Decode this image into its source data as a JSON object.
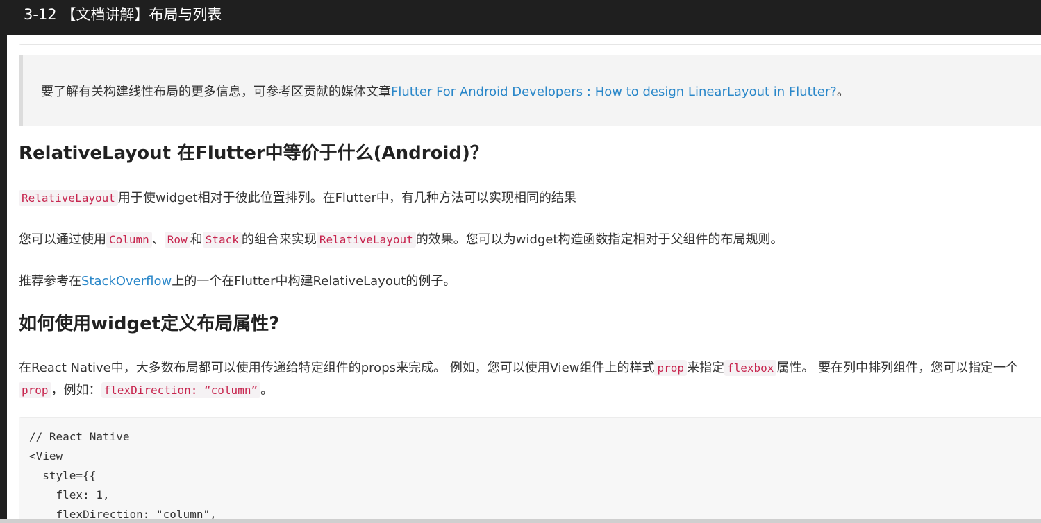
{
  "window": {
    "title": "3-12 【文档讲解】布局与列表"
  },
  "blockquote": {
    "text": "要了解有关构建线性布局的更多信息，可参考区贡献的媒体文章",
    "link": "Flutter For Android Developers : How to design LinearLayout in Flutter?",
    "suffix": "。"
  },
  "section1": {
    "heading": "RelativeLayout 在Flutter中等价于什么(Android)？",
    "p1": {
      "code": "RelativeLayout",
      "text": "用于使widget相对于彼此位置排列。在Flutter中，有几种方法可以实现相同的结果"
    },
    "p2": {
      "t1": "您可以通过使用",
      "c1": "Column",
      "t2": "、",
      "c2": "Row",
      "t3": "和",
      "c3": "Stack",
      "t4": "的组合来实现",
      "c4": "RelativeLayout",
      "t5": "的效果。您可以为widget构造函数指定相对于父组件的布局规则。"
    },
    "p3": {
      "t1": "推荐参考在",
      "link": "StackOverflow",
      "t2": "上的一个在Flutter中构建RelativeLayout的例子。"
    }
  },
  "section2": {
    "heading": "如何使用widget定义布局属性?",
    "p1": {
      "t1": "在React Native中，大多数布局都可以使用传递给特定组件的props来完成。 例如，您可以使用View组件上的样式",
      "c1": "prop",
      "t2": "来指定",
      "c2": "flexbox",
      "t3": "属性。 要在列中排列组件，您可以指定一个",
      "c3": "prop",
      "t4": "，例如：",
      "c4": "flexDirection: “column”",
      "t5": "。"
    },
    "code_lines": [
      "// React Native",
      "<View",
      "  style={{",
      "    flex: 1,",
      "    flexDirection: \"column\","
    ]
  }
}
